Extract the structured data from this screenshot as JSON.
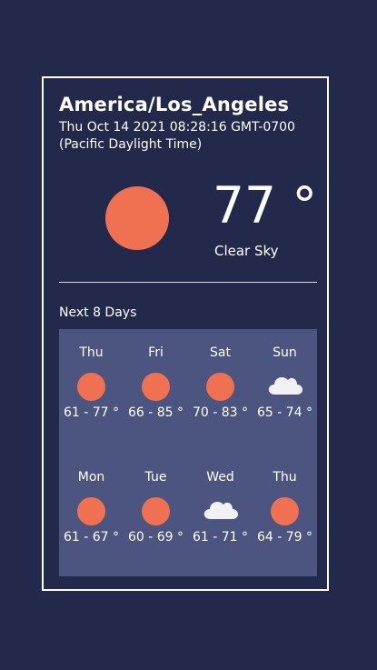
{
  "location": {
    "timezone": "America/Los_Angeles",
    "datetime": "Thu Oct 14 2021 08:28:16 GMT-0700 (Pacific Daylight Time)"
  },
  "current": {
    "icon": "sun-icon",
    "temperature": "77 °",
    "condition": "Clear Sky"
  },
  "forecast": {
    "label": "Next 8 Days",
    "days": [
      {
        "name": "Thu",
        "icon": "sun-icon",
        "range": "61 - 77 °"
      },
      {
        "name": "Fri",
        "icon": "sun-icon",
        "range": "66 - 85 °"
      },
      {
        "name": "Sat",
        "icon": "sun-icon",
        "range": "70 - 83 °"
      },
      {
        "name": "Sun",
        "icon": "cloud-icon",
        "range": "65 - 74 °"
      },
      {
        "name": "Mon",
        "icon": "sun-icon",
        "range": "61 - 67 °"
      },
      {
        "name": "Tue",
        "icon": "sun-icon",
        "range": "60 - 69 °"
      },
      {
        "name": "Wed",
        "icon": "cloud-icon",
        "range": "61 - 71 °"
      },
      {
        "name": "Thu",
        "icon": "sun-icon",
        "range": "64 - 79 °"
      }
    ]
  },
  "colors": {
    "background": "#23294a",
    "panel": "#4c557f",
    "sun": "#ef7152",
    "text": "#ffffff"
  }
}
